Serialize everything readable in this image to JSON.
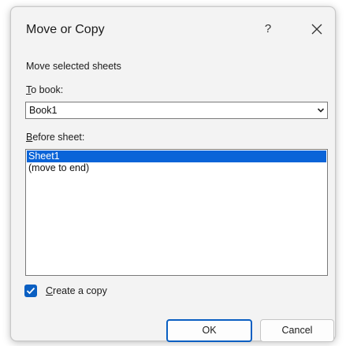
{
  "dialog": {
    "title": "Move or Copy",
    "help_label": "?",
    "subtitle": "Move selected sheets"
  },
  "to_book": {
    "label_mnemonic": "T",
    "label_rest": "o book:",
    "selected_value": "Book1"
  },
  "before_sheet": {
    "label_mnemonic": "B",
    "label_rest": "efore sheet:",
    "items": [
      {
        "label": "Sheet1",
        "selected": true
      },
      {
        "label": "(move to end)",
        "selected": false
      }
    ]
  },
  "create_copy": {
    "checked": true,
    "label_mnemonic": "C",
    "label_rest": "reate a copy"
  },
  "buttons": {
    "ok_label": "OK",
    "cancel_label": "Cancel"
  },
  "colors": {
    "accent": "#0a5fc2",
    "selection": "#0a64d8"
  }
}
